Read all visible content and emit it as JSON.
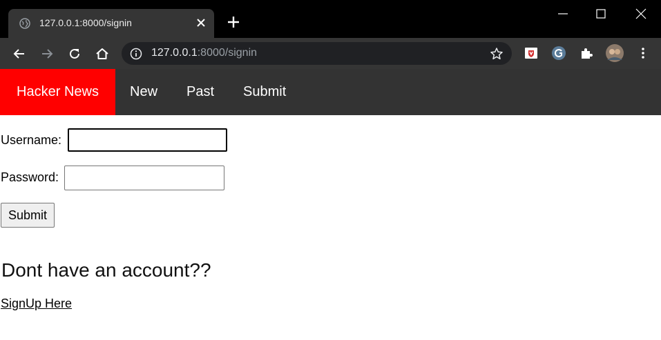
{
  "browser": {
    "tab": {
      "title": "127.0.0.1:8000/signin",
      "favicon": "globe-icon",
      "close": "close-icon"
    },
    "new_tab": "plus-icon",
    "window_controls": [
      "minimize-icon",
      "maximize-icon",
      "close-icon"
    ],
    "nav_buttons": [
      "back-arrow-icon",
      "forward-arrow-icon",
      "reload-icon",
      "home-icon"
    ],
    "address": {
      "host": "127.0.0.1",
      "rest": ":8000/signin",
      "info_icon": "info-icon",
      "bookmark_icon": "star-icon"
    },
    "extensions": [
      "shield-extension-icon",
      "grammarly-extension-icon",
      "puzzle-extensions-icon",
      "profile-avatar",
      "kebab-menu-icon"
    ]
  },
  "nav": {
    "brand": "Hacker News",
    "links": [
      "New",
      "Past",
      "Submit"
    ],
    "colors": {
      "brand_bg": "#ff0000",
      "bar_bg": "#333333"
    }
  },
  "form": {
    "username_label": "Username:",
    "username_value": "",
    "password_label": "Password:",
    "password_value": "",
    "submit_label": "Submit"
  },
  "signup": {
    "prompt": "Dont have an account??",
    "link": "SignUp Here"
  }
}
